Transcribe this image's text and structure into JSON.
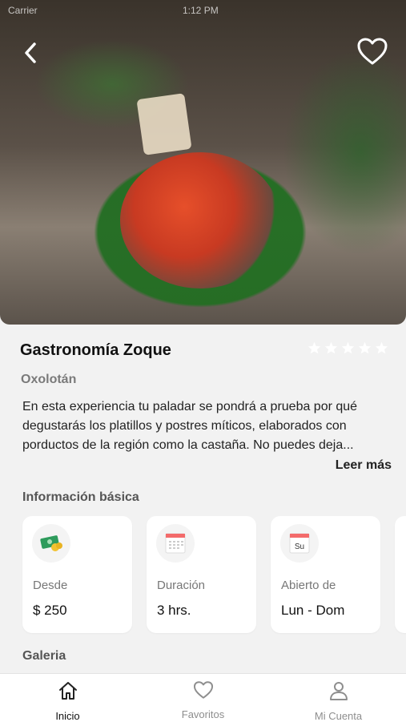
{
  "status_bar": {
    "carrier": "Carrier",
    "time": "1:12 PM"
  },
  "header": {
    "back_icon": "chevron-left-icon",
    "favorite_icon": "heart-outline-icon"
  },
  "experience": {
    "title": "Gastronomía Zoque",
    "location": "Oxolotán",
    "rating_stars": 0,
    "rating_max": 5,
    "description": "En esta experiencia tu paladar se pondrá a prueba por qué degustarás los platillos y postres míticos, elaborados con porductos de la región como la castaña. No puedes deja...",
    "read_more": "Leer más"
  },
  "basic_info": {
    "title": "Información básica",
    "cards": [
      {
        "icon": "money-icon",
        "label": "Desde",
        "value": "$ 250"
      },
      {
        "icon": "calendar-icon",
        "label": "Duración",
        "value": "3 hrs."
      },
      {
        "icon": "calendar-su-icon",
        "icon_text": "Su",
        "label": "Abierto de",
        "value": "Lun - Dom"
      }
    ]
  },
  "gallery": {
    "title": "Galeria"
  },
  "tabs": [
    {
      "label": "Inicio",
      "icon": "home-icon",
      "active": true
    },
    {
      "label": "Favoritos",
      "icon": "heart-icon",
      "active": false
    },
    {
      "label": "Mi Cuenta",
      "icon": "user-icon",
      "active": false
    }
  ],
  "colors": {
    "accent": "#f36b6b",
    "money": "#2e9b5c",
    "text_secondary": "#7a7a7a"
  }
}
